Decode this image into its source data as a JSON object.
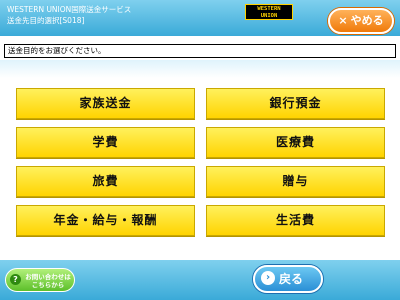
{
  "header": {
    "title_line1": "WESTERN UNION国際送金サービス",
    "title_line2": "送金先目的選択[S018]",
    "logo_line1": "WESTERN",
    "logo_line2": "UNION",
    "cancel_label": "やめる",
    "cancel_icon": "close-icon"
  },
  "instruction": "送金目的をお選びください。",
  "options": [
    {
      "label": "家族送金"
    },
    {
      "label": "銀行預金"
    },
    {
      "label": "学費"
    },
    {
      "label": "医療費"
    },
    {
      "label": "旅費"
    },
    {
      "label": "贈与"
    },
    {
      "label": "年金・給与・報酬"
    },
    {
      "label": "生活費"
    }
  ],
  "footer": {
    "help_line1": "お問い合わせは",
    "help_line2": "こちらから",
    "help_icon": "question-icon",
    "back_label": "戻る",
    "back_icon": "arrow-icon"
  },
  "colors": {
    "header_blue": "#3aaad8",
    "option_yellow": "#ffd400",
    "cancel_orange": "#f07a0a",
    "help_green": "#5cbf2a",
    "back_blue": "#2a8fd6"
  }
}
